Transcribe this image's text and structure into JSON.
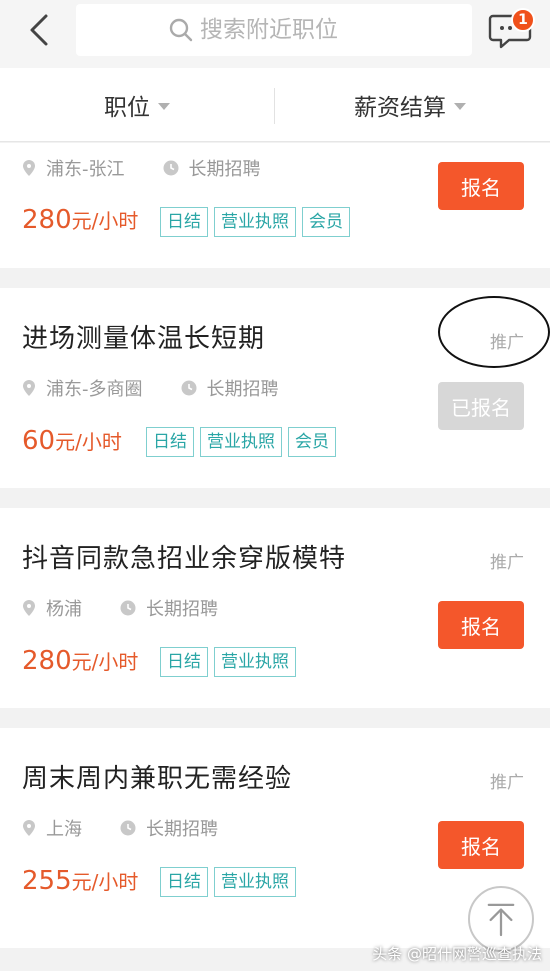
{
  "header": {
    "search_placeholder": "搜索附近职位",
    "message_count": "1"
  },
  "filters": {
    "position_label": "职位",
    "salary_label": "薪资结算"
  },
  "jobs": [
    {
      "title": "",
      "location": "浦东-张江",
      "duration": "长期招聘",
      "price": "280",
      "unit": "元/小时",
      "tags": [
        "日结",
        "营业执照",
        "会员"
      ],
      "button": "报名"
    },
    {
      "title": "进场测量体温长短期",
      "promo": "推广",
      "location": "浦东-多商圈",
      "duration": "长期招聘",
      "price": "60",
      "unit": "元/小时",
      "tags": [
        "日结",
        "营业执照",
        "会员"
      ],
      "button": "已报名"
    },
    {
      "title": "抖音同款急招业余穿版模特",
      "promo": "推广",
      "location": "杨浦",
      "duration": "长期招聘",
      "price": "280",
      "unit": "元/小时",
      "tags": [
        "日结",
        "营业执照"
      ],
      "button": "报名"
    },
    {
      "title": "周末周内兼职无需经验",
      "promo": "推广",
      "location": "上海",
      "duration": "长期招聘",
      "price": "255",
      "unit": "元/小时",
      "tags": [
        "日结",
        "营业执照"
      ],
      "button": "报名"
    }
  ],
  "watermark": "头条 @昭什网警巡查执法",
  "colors": {
    "accent": "#f4572b",
    "price": "#e55a2b",
    "tag": "#2aa6a6",
    "disabled": "#d7d7d7"
  }
}
